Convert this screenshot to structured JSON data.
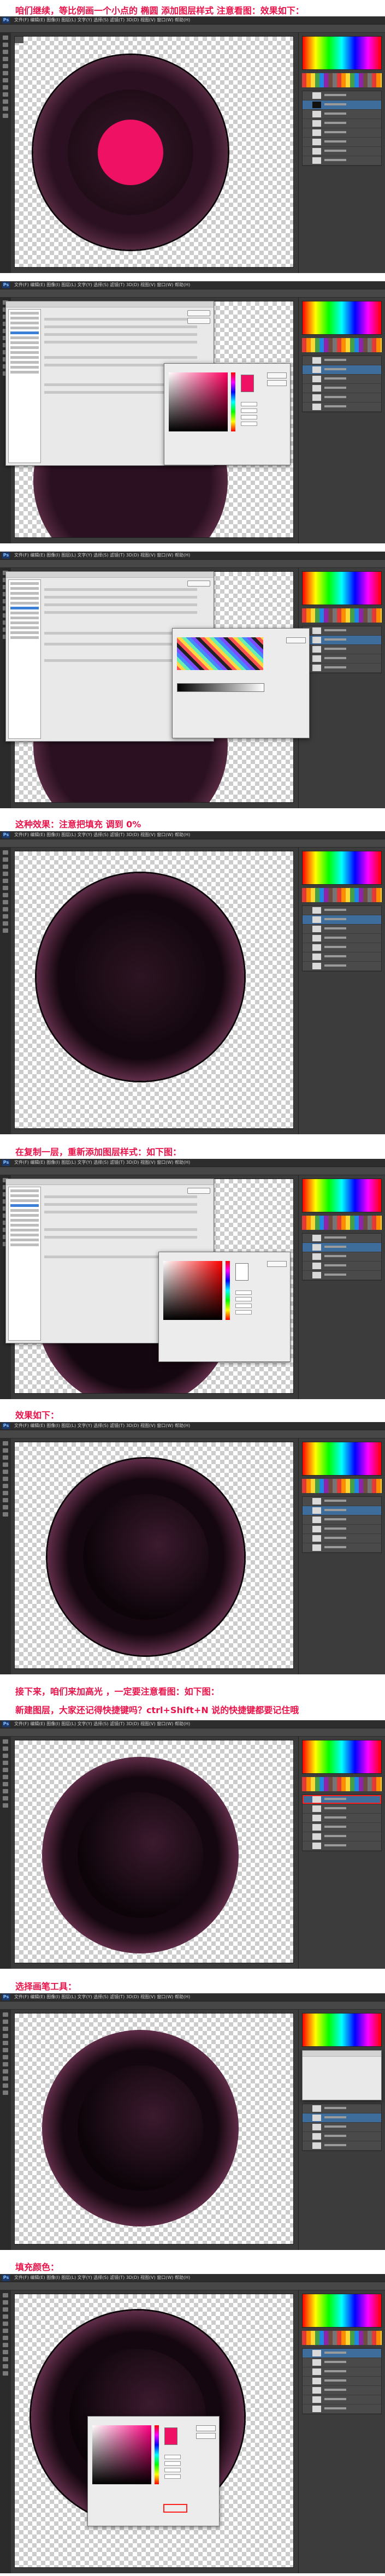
{
  "captions": {
    "c1": "咱们继续，等比例画一个小点的 椭圆 添加图层样式  注意看图：效果如下：",
    "c2": "这种效果：注意把填充 调到 0%",
    "c3": "在复制一层，重新添加图层样式：如下图：",
    "c4": "效果如下：",
    "c5": "接下来，咱们来加高光 ，一定要注意看图：如下图：",
    "c6": "新建图层，大家还记得快捷键吗？ctrl+Shift+N   说的快捷键都要记住哦",
    "c7": "选择画笔工具：",
    "c8": "填充颜色："
  },
  "app": {
    "logo": "Ps",
    "menus": "文件(F)  编辑(E)  图像(I)  图层(L)  文字(Y)  选择(S)  滤镜(T)  3D(D)  视图(V)  窗口(W)  帮助(H)"
  },
  "colors": {
    "accent": "#e8134a",
    "pink_fill": "#ee1164",
    "ring_dark": "#120810",
    "ring_purple": "#4a2338",
    "highlight": "#ff2020"
  },
  "icons": [
    "ps-logo-icon",
    "tool-icon",
    "color-field-icon",
    "hue-slider-icon",
    "gradient-preset-icon"
  ]
}
